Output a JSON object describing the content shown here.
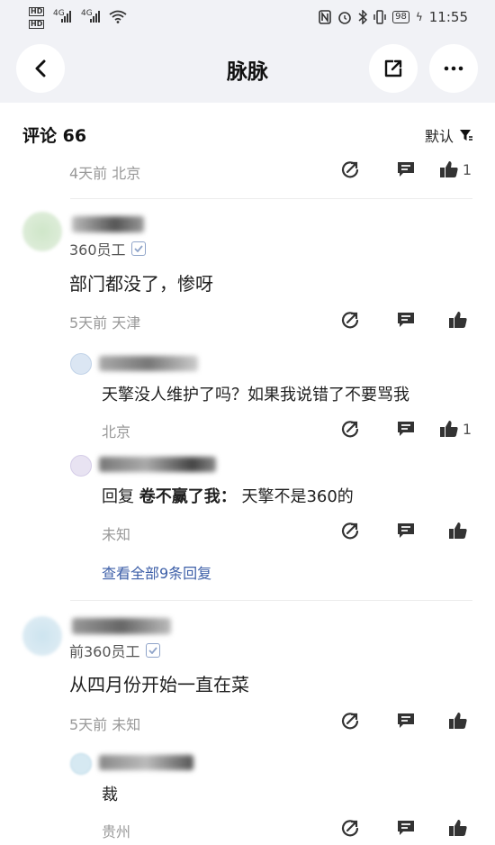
{
  "status_bar": {
    "left_label": "HD 4G",
    "battery": "98",
    "time": "11:55"
  },
  "nav": {
    "title": "脉脉",
    "back_icon": "back-arrow-icon",
    "share_icon": "share-icon",
    "more_icon": "more-icon"
  },
  "comments_header": {
    "title": "评论 66",
    "sort_label": "默认"
  },
  "comments": [
    {
      "meta": "4天前  北京",
      "like_count": "1"
    },
    {
      "role": "360员工",
      "content": "部门都没了，惨呀",
      "meta": "5天前  天津",
      "like_count": ""
    },
    {
      "content": "天擎没人维护了吗？如果我说错了不要骂我",
      "meta": "北京",
      "like_count": "1"
    },
    {
      "reply_prefix": "回复 ",
      "reply_target": "卷不赢了我：",
      "content": " 天擎不是360的",
      "meta": "未知",
      "like_count": ""
    },
    {
      "view_all": "查看全部9条回复"
    },
    {
      "role": "前360员工",
      "content": "从四月份开始一直在菜",
      "meta": "5天前  未知",
      "like_count": ""
    },
    {
      "content": "裁",
      "meta": "贵州",
      "like_count": ""
    }
  ],
  "colors": {
    "accent_link": "#3d5fa8",
    "header_bg": "#f1f2f6",
    "meta_text": "#999999"
  }
}
